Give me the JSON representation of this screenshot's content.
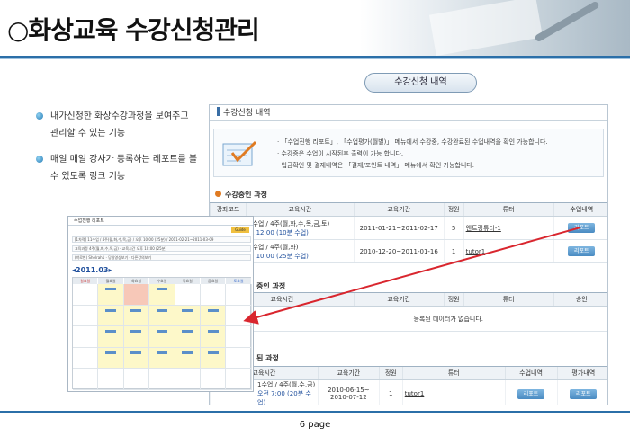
{
  "header": {
    "title": "○화상교육 수강신청관리"
  },
  "section_pill": "수강신청 내역",
  "bullets": [
    "내가신청한 화상수강과정을 보여주고 관리할 수 있는 기능",
    "매일 매일 강사가 등록하는 레포트를 볼 수 있도록 링크 기능"
  ],
  "panel": {
    "title": "수강신청 내역",
    "notices": [
      "· 「수업진행 리포트」, 「수업평가(월별)」 메뉴에서 수강중, 수강완료된 수업내역을 확인 가능합니다.",
      "· 수강증은 수업이 시작된후 출력이 가능 합니다.",
      "· 입금확인 및 결재내역은 「결재/포인트 내역」 메뉴에서 확인 가능합니다."
    ],
    "current": {
      "heading": "수강중인 과정",
      "columns": [
        "강좌코드",
        "교육시간",
        "교육기간",
        "정원",
        "튜터",
        "수업내역"
      ],
      "rows": [
        {
          "code": "",
          "time1": "5수업 / 4주(월,화,수,목,금,토)",
          "time2": "오 12:00 (10분 수업)",
          "period": "2011-01-21~2011-02-17",
          "cap": "5",
          "tutor": "엔트링튜터-1",
          "action": "리포트"
        },
        {
          "code": "",
          "time1": "1수업 / 4주(월,화)",
          "time2": "전 10:00 (25분 수업)",
          "period": "2010-12-20~2011-01-16",
          "cap": "1",
          "tutor": "tutor1",
          "action": "리포트"
        }
      ]
    },
    "waiting": {
      "heading": "중인 과정",
      "columns": [
        "교육시간",
        "교육기간",
        "정원",
        "튜터",
        "승인"
      ],
      "empty": "등록된 데이터가 없습니다."
    },
    "done": {
      "heading": "된 과정",
      "columns": [
        "교육시간",
        "교육기간",
        "정원",
        "튜터",
        "수업내역",
        "평가내역"
      ],
      "rows": [
        {
          "time1": "1수업 / 4주(월,수,금)",
          "time2": "오전 7:00 (20분 수업)",
          "period1": "2010-06-15~",
          "period2": "2010-07-12",
          "cap": "1",
          "tutor": "tutor1",
          "action1": "리포트",
          "action2": "리포트"
        }
      ]
    }
  },
  "shot": {
    "title": "수업진행 리포트",
    "guide": "Guide",
    "row1": "[1차적] 11수업 / 4주(월,화,수,목,금) / 오후 10:00 (25분) / 2011-02-21~2011-03-09",
    "row2": "교육과정 4주(월,화,수,목,금) · 교육시간 오후 10:00 (25분)",
    "row3": "(박로빈) Shelrah1 · 당일영상보기 · 다른강의보기",
    "month": "2011.03",
    "days": [
      "일요일",
      "월요일",
      "화요일",
      "수요일",
      "목요일",
      "금요일",
      "토요일"
    ]
  },
  "footer": {
    "page": "6 page"
  },
  "colors": {
    "accent": "#2b6fa8",
    "button": "#4a8bc2",
    "arrow": "#d9262e"
  }
}
